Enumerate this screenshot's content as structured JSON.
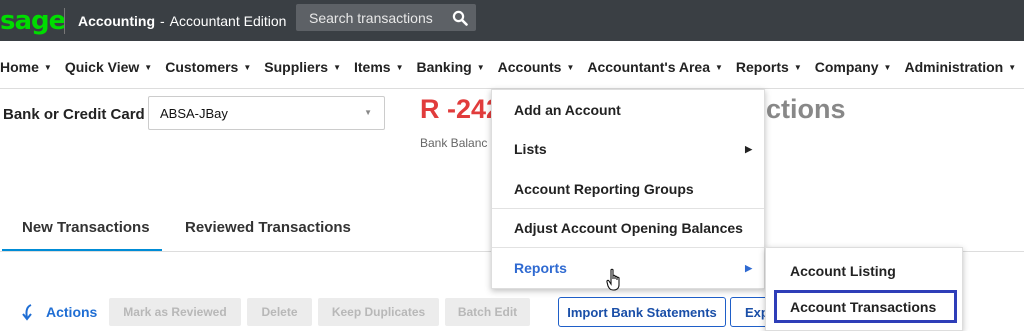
{
  "topbar": {
    "logo": "sage",
    "app_title": "Accounting",
    "app_dash": "-",
    "edition": "Accountant Edition",
    "search_placeholder": "Search transactions"
  },
  "nav": {
    "items": [
      {
        "label": "Home"
      },
      {
        "label": "Quick View"
      },
      {
        "label": "Customers"
      },
      {
        "label": "Suppliers"
      },
      {
        "label": "Items"
      },
      {
        "label": "Banking"
      },
      {
        "label": "Accounts"
      },
      {
        "label": "Accountant's Area"
      },
      {
        "label": "Reports"
      },
      {
        "label": "Company"
      },
      {
        "label": "Administration"
      }
    ]
  },
  "bank": {
    "label": "Bank or Credit Card",
    "selected": "ABSA-JBay",
    "balance": "R -242",
    "balance_label": "Bank Balanc",
    "title_fragment": "ctions"
  },
  "tabs": [
    {
      "label": "New Transactions"
    },
    {
      "label": "Reviewed Transactions"
    }
  ],
  "actions": {
    "label": "Actions",
    "mark_reviewed": "Mark as Reviewed",
    "delete": "Delete",
    "keep_duplicates": "Keep Duplicates",
    "batch_edit": "Batch Edit",
    "import": "Import Bank Statements",
    "export": "Exp"
  },
  "accounts_menu": {
    "items": [
      {
        "label": "Add an Account"
      },
      {
        "label": "Lists"
      },
      {
        "label": "Account Reporting Groups"
      },
      {
        "label": "Adjust Account Opening Balances"
      },
      {
        "label": "Reports"
      }
    ]
  },
  "reports_submenu": {
    "items": [
      {
        "label": "Account Listing"
      },
      {
        "label": "Account Transactions"
      }
    ]
  },
  "colors": {
    "topbar_bg": "#3a3f44",
    "logo": "#00dc00",
    "balance": "#e13c3c",
    "accent": "#2f6ad1",
    "highlight_box": "#2e3eb8"
  }
}
